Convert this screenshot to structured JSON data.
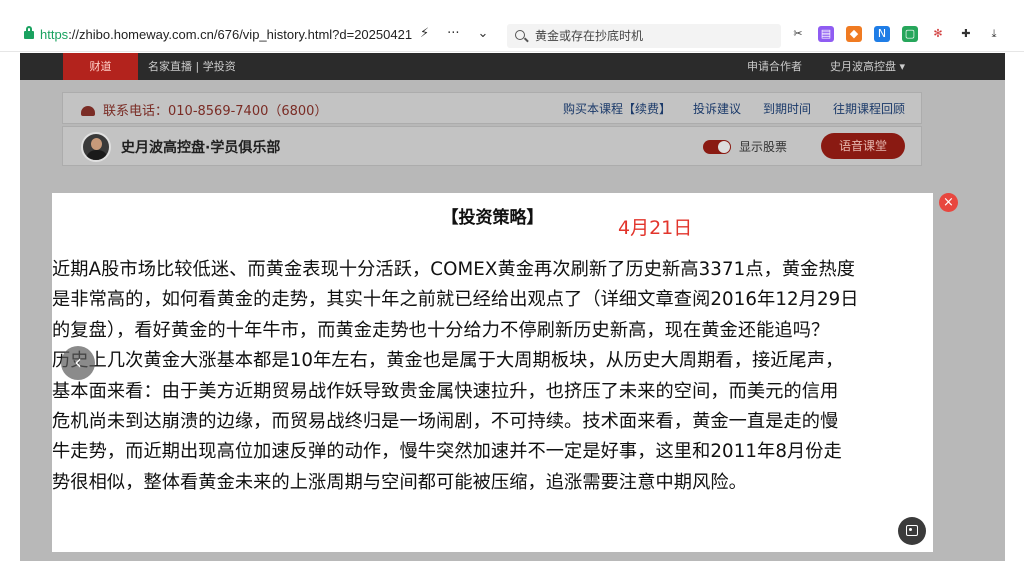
{
  "browser": {
    "url_scheme": "https",
    "url_rest": "://zhibo.homeway.com.cn/676/vip_history.html?d=20250421",
    "search_text": "黄金或存在抄底时机",
    "action_bolt": "⚡",
    "action_more": "···",
    "action_chevron": "⌄"
  },
  "site_nav": {
    "home": "财道",
    "links": "名家直播  |  学投资",
    "apply": "申请合作者",
    "club": "史月波高控盘 ▾"
  },
  "info_bar": {
    "phone": "联系电话：010-8569-7400（6800）",
    "links": [
      "购买本课程【续费】",
      "投诉建议",
      "到期时间",
      "往期课程回顾"
    ]
  },
  "club_bar": {
    "name": "史月波高控盘·学员俱乐部",
    "toggle_label": "显示股票",
    "voice_button": "语音课堂"
  },
  "modal": {
    "title": "【投资策略】",
    "date": "4月21日",
    "lines": [
      "近期A股市场比较低迷、而黄金表现十分活跃，COMEX黄金再次刷新了历史新高3371点，黄金热度",
      "是非常高的，如何看黄金的走势，其实十年之前就已经给出观点了（详细文章查阅2016年12月29日",
      "的复盘），看好黄金的十年牛市，而黄金走势也十分给力不停刷新历史新高，现在黄金还能追吗？",
      "历史上几次黄金大涨基本都是10年左右，黄金也是属于大周期板块，从历史大周期看，接近尾声，",
      "基本面来看：由于美方近期贸易战作妖导致贵金属快速拉升，也挤压了未来的空间，而美元的信用",
      "危机尚未到达崩溃的边缘，而贸易战终归是一场闹剧，不可持续。技术面来看，黄金一直是走的慢",
      "牛走势，而近期出现高位加速反弹的动作，慢牛突然加速并不一定是好事，这里和2011年8月份走",
      "势很相似，整体看黄金未来的上涨周期与空间都可能被压缩，追涨需要注意中期风险。"
    ],
    "close_glyph": "×",
    "prev_glyph": "‹"
  },
  "colors": {
    "accent_red": "#e2352c",
    "nav_dark": "#2b2b2b"
  }
}
